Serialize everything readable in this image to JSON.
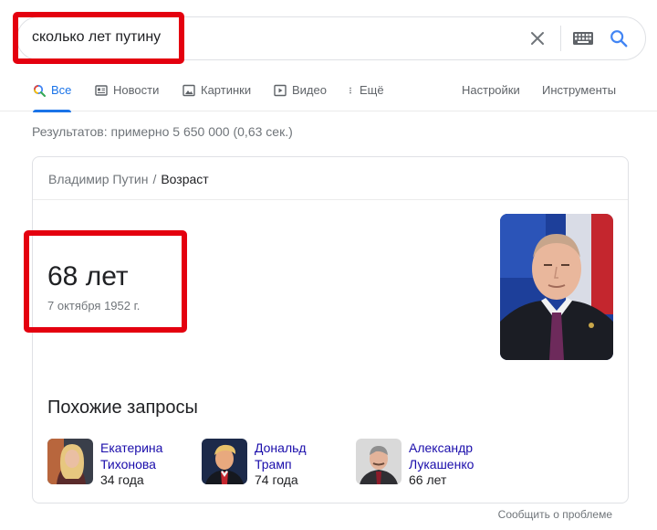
{
  "search": {
    "query": "сколько лет путину",
    "highlight_color": "#e4000f"
  },
  "tabs": [
    {
      "label": "Все",
      "icon": "search-multicolor-icon",
      "active": true
    },
    {
      "label": "Новости",
      "icon": "newspaper-icon"
    },
    {
      "label": "Картинки",
      "icon": "image-icon"
    },
    {
      "label": "Видео",
      "icon": "play-icon"
    },
    {
      "label": "Ещё",
      "icon": "more-vert-icon"
    },
    {
      "label": "Настройки"
    },
    {
      "label": "Инструменты"
    }
  ],
  "result_stats": "Результатов: примерно 5 650 000 (0,63 сек.)",
  "card": {
    "breadcrumb": {
      "parent": "Владимир Путин",
      "separator": "/",
      "current": "Возраст"
    },
    "age_value": "68 лет",
    "birth_date": "7 октября 1952 г.",
    "portrait_icon": "person-portrait-photo",
    "similar_title": "Похожие запросы",
    "similar": [
      {
        "line1": "Екатерина",
        "line2": "Тихонова",
        "age": "34 года"
      },
      {
        "line1": "Дональд",
        "line2": "Трамп",
        "age": "74 года"
      },
      {
        "line1": "Александр",
        "line2": "Лукашенко",
        "age": "66 лет"
      }
    ]
  },
  "feedback": "Сообщить о проблеме",
  "colors": {
    "accent": "#1a73e8",
    "link": "#1a0dab",
    "muted": "#70757a"
  }
}
